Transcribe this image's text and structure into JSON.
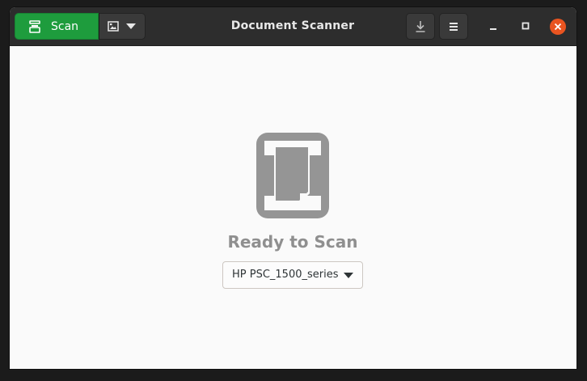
{
  "window": {
    "title": "Document Scanner"
  },
  "toolbar": {
    "scan_label": "Scan",
    "scan_icon": "scanner-icon",
    "scan_type_icon": "image-icon",
    "save_icon": "download-icon",
    "menu_icon": "hamburger-menu-icon"
  },
  "window_controls": {
    "minimize_icon": "minimize-icon",
    "maximize_icon": "maximize-icon",
    "close_icon": "close-icon"
  },
  "main": {
    "placeholder_icon": "document-icon",
    "status": "Ready to Scan",
    "device": {
      "selected": "HP PSC_1500_series"
    }
  },
  "colors": {
    "accent_green": "#1e9c3d",
    "close_orange": "#e95420",
    "headerbar": "#2d2d2d",
    "content_bg": "#fafafa",
    "status_text": "#8f8f8f"
  }
}
